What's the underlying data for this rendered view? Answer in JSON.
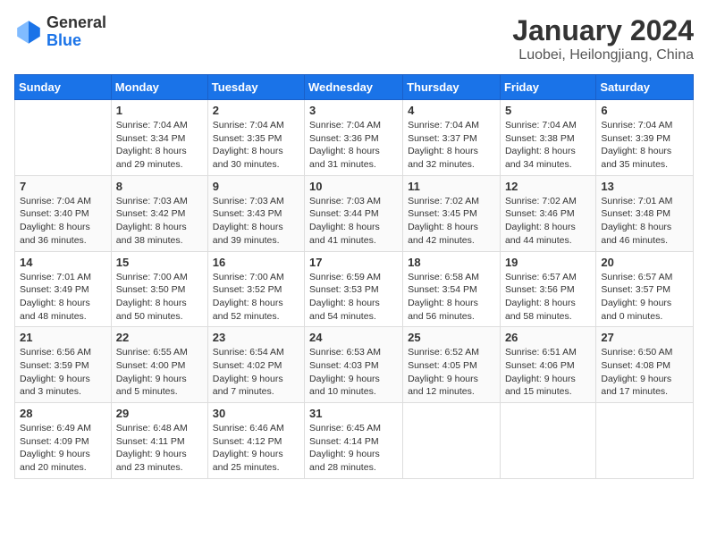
{
  "header": {
    "logo": {
      "line1": "General",
      "line2": "Blue"
    },
    "title": "January 2024",
    "subtitle": "Luobei, Heilongjiang, China"
  },
  "weekdays": [
    "Sunday",
    "Monday",
    "Tuesday",
    "Wednesday",
    "Thursday",
    "Friday",
    "Saturday"
  ],
  "weeks": [
    [
      {
        "day": "",
        "sunrise": "",
        "sunset": "",
        "daylight": ""
      },
      {
        "day": "1",
        "sunrise": "Sunrise: 7:04 AM",
        "sunset": "Sunset: 3:34 PM",
        "daylight": "Daylight: 8 hours and 29 minutes."
      },
      {
        "day": "2",
        "sunrise": "Sunrise: 7:04 AM",
        "sunset": "Sunset: 3:35 PM",
        "daylight": "Daylight: 8 hours and 30 minutes."
      },
      {
        "day": "3",
        "sunrise": "Sunrise: 7:04 AM",
        "sunset": "Sunset: 3:36 PM",
        "daylight": "Daylight: 8 hours and 31 minutes."
      },
      {
        "day": "4",
        "sunrise": "Sunrise: 7:04 AM",
        "sunset": "Sunset: 3:37 PM",
        "daylight": "Daylight: 8 hours and 32 minutes."
      },
      {
        "day": "5",
        "sunrise": "Sunrise: 7:04 AM",
        "sunset": "Sunset: 3:38 PM",
        "daylight": "Daylight: 8 hours and 34 minutes."
      },
      {
        "day": "6",
        "sunrise": "Sunrise: 7:04 AM",
        "sunset": "Sunset: 3:39 PM",
        "daylight": "Daylight: 8 hours and 35 minutes."
      }
    ],
    [
      {
        "day": "7",
        "sunrise": "Sunrise: 7:04 AM",
        "sunset": "Sunset: 3:40 PM",
        "daylight": "Daylight: 8 hours and 36 minutes."
      },
      {
        "day": "8",
        "sunrise": "Sunrise: 7:03 AM",
        "sunset": "Sunset: 3:42 PM",
        "daylight": "Daylight: 8 hours and 38 minutes."
      },
      {
        "day": "9",
        "sunrise": "Sunrise: 7:03 AM",
        "sunset": "Sunset: 3:43 PM",
        "daylight": "Daylight: 8 hours and 39 minutes."
      },
      {
        "day": "10",
        "sunrise": "Sunrise: 7:03 AM",
        "sunset": "Sunset: 3:44 PM",
        "daylight": "Daylight: 8 hours and 41 minutes."
      },
      {
        "day": "11",
        "sunrise": "Sunrise: 7:02 AM",
        "sunset": "Sunset: 3:45 PM",
        "daylight": "Daylight: 8 hours and 42 minutes."
      },
      {
        "day": "12",
        "sunrise": "Sunrise: 7:02 AM",
        "sunset": "Sunset: 3:46 PM",
        "daylight": "Daylight: 8 hours and 44 minutes."
      },
      {
        "day": "13",
        "sunrise": "Sunrise: 7:01 AM",
        "sunset": "Sunset: 3:48 PM",
        "daylight": "Daylight: 8 hours and 46 minutes."
      }
    ],
    [
      {
        "day": "14",
        "sunrise": "Sunrise: 7:01 AM",
        "sunset": "Sunset: 3:49 PM",
        "daylight": "Daylight: 8 hours and 48 minutes."
      },
      {
        "day": "15",
        "sunrise": "Sunrise: 7:00 AM",
        "sunset": "Sunset: 3:50 PM",
        "daylight": "Daylight: 8 hours and 50 minutes."
      },
      {
        "day": "16",
        "sunrise": "Sunrise: 7:00 AM",
        "sunset": "Sunset: 3:52 PM",
        "daylight": "Daylight: 8 hours and 52 minutes."
      },
      {
        "day": "17",
        "sunrise": "Sunrise: 6:59 AM",
        "sunset": "Sunset: 3:53 PM",
        "daylight": "Daylight: 8 hours and 54 minutes."
      },
      {
        "day": "18",
        "sunrise": "Sunrise: 6:58 AM",
        "sunset": "Sunset: 3:54 PM",
        "daylight": "Daylight: 8 hours and 56 minutes."
      },
      {
        "day": "19",
        "sunrise": "Sunrise: 6:57 AM",
        "sunset": "Sunset: 3:56 PM",
        "daylight": "Daylight: 8 hours and 58 minutes."
      },
      {
        "day": "20",
        "sunrise": "Sunrise: 6:57 AM",
        "sunset": "Sunset: 3:57 PM",
        "daylight": "Daylight: 9 hours and 0 minutes."
      }
    ],
    [
      {
        "day": "21",
        "sunrise": "Sunrise: 6:56 AM",
        "sunset": "Sunset: 3:59 PM",
        "daylight": "Daylight: 9 hours and 3 minutes."
      },
      {
        "day": "22",
        "sunrise": "Sunrise: 6:55 AM",
        "sunset": "Sunset: 4:00 PM",
        "daylight": "Daylight: 9 hours and 5 minutes."
      },
      {
        "day": "23",
        "sunrise": "Sunrise: 6:54 AM",
        "sunset": "Sunset: 4:02 PM",
        "daylight": "Daylight: 9 hours and 7 minutes."
      },
      {
        "day": "24",
        "sunrise": "Sunrise: 6:53 AM",
        "sunset": "Sunset: 4:03 PM",
        "daylight": "Daylight: 9 hours and 10 minutes."
      },
      {
        "day": "25",
        "sunrise": "Sunrise: 6:52 AM",
        "sunset": "Sunset: 4:05 PM",
        "daylight": "Daylight: 9 hours and 12 minutes."
      },
      {
        "day": "26",
        "sunrise": "Sunrise: 6:51 AM",
        "sunset": "Sunset: 4:06 PM",
        "daylight": "Daylight: 9 hours and 15 minutes."
      },
      {
        "day": "27",
        "sunrise": "Sunrise: 6:50 AM",
        "sunset": "Sunset: 4:08 PM",
        "daylight": "Daylight: 9 hours and 17 minutes."
      }
    ],
    [
      {
        "day": "28",
        "sunrise": "Sunrise: 6:49 AM",
        "sunset": "Sunset: 4:09 PM",
        "daylight": "Daylight: 9 hours and 20 minutes."
      },
      {
        "day": "29",
        "sunrise": "Sunrise: 6:48 AM",
        "sunset": "Sunset: 4:11 PM",
        "daylight": "Daylight: 9 hours and 23 minutes."
      },
      {
        "day": "30",
        "sunrise": "Sunrise: 6:46 AM",
        "sunset": "Sunset: 4:12 PM",
        "daylight": "Daylight: 9 hours and 25 minutes."
      },
      {
        "day": "31",
        "sunrise": "Sunrise: 6:45 AM",
        "sunset": "Sunset: 4:14 PM",
        "daylight": "Daylight: 9 hours and 28 minutes."
      },
      {
        "day": "",
        "sunrise": "",
        "sunset": "",
        "daylight": ""
      },
      {
        "day": "",
        "sunrise": "",
        "sunset": "",
        "daylight": ""
      },
      {
        "day": "",
        "sunrise": "",
        "sunset": "",
        "daylight": ""
      }
    ]
  ]
}
